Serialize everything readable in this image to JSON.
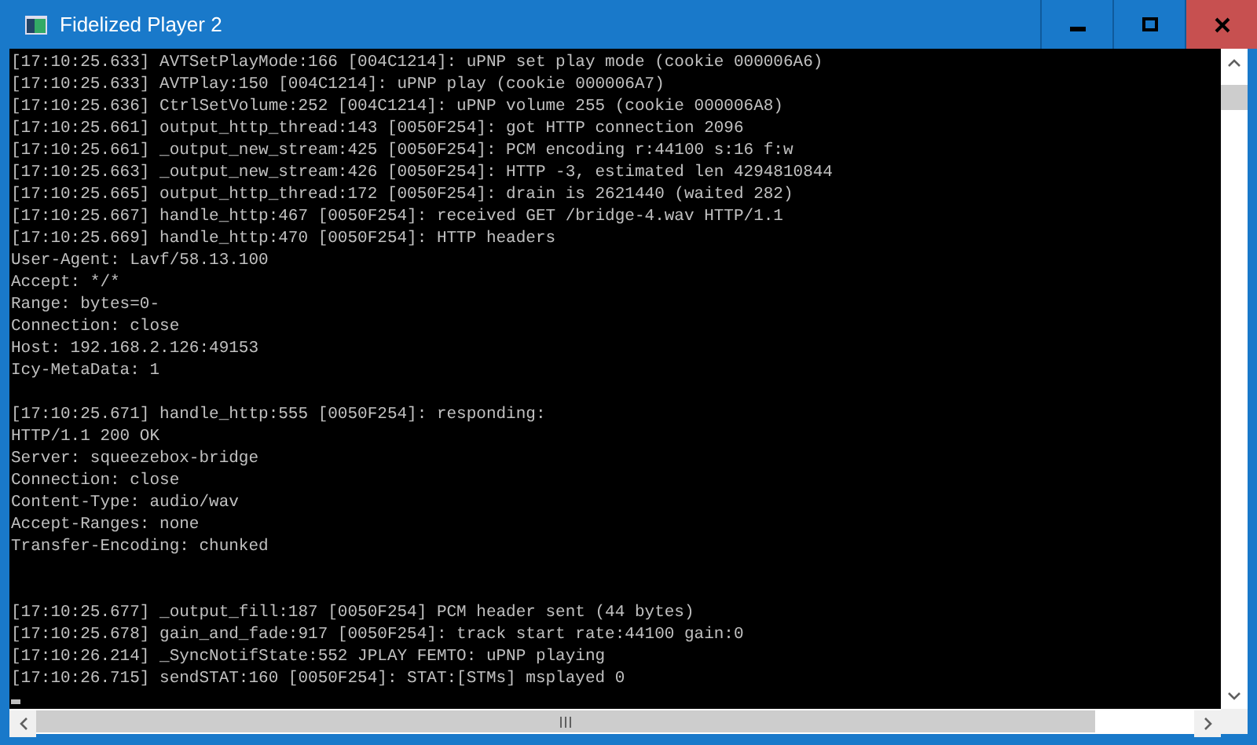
{
  "window": {
    "title": "Fidelized Player 2"
  },
  "console": {
    "lines": [
      {
        "text": "[17:10:25.633] AVTSetPlayMode:166 [004C1214]: uPNP set play mode (cookie 000006A6)"
      },
      {
        "text": "[17:10:25.633] AVTPlay:150 [004C1214]: uPNP play (cookie 000006A7)"
      },
      {
        "text": "[17:10:25.636] CtrlSetVolume:252 [004C1214]: uPNP volume 255 (cookie 000006A8)"
      },
      {
        "text": "[17:10:25.661] output_http_thread:143 [0050F254]: got HTTP connection 2096"
      },
      {
        "text": "[17:10:25.661] _output_new_stream:425 [0050F254]: PCM encoding r:44100 s:16 f:w"
      },
      {
        "text": "[17:10:25.663] _output_new_stream:426 [0050F254]: HTTP -3, estimated len 4294810844"
      },
      {
        "text": "[17:10:25.665] output_http_thread:172 [0050F254]: drain is 2621440 (waited 282)"
      },
      {
        "text": "[17:10:25.667] handle_http:467 [0050F254]: received GET /bridge-4.wav HTTP/1.1"
      },
      {
        "text": "[17:10:25.669] handle_http:470 [0050F254]: HTTP headers"
      },
      {
        "text": "User-Agent: Lavf/58.13.100"
      },
      {
        "text": "Accept: */*"
      },
      {
        "text": "Range: bytes=0-"
      },
      {
        "text": "Connection: close"
      },
      {
        "text": "Host: 192.168.2.126:49153"
      },
      {
        "text": "Icy-MetaData: 1"
      },
      {
        "kind": "blank"
      },
      {
        "text": "[17:10:25.671] handle_http:555 [0050F254]: responding:"
      },
      {
        "text": "HTTP/1.1 200 OK"
      },
      {
        "text": "Server: squeezebox-bridge"
      },
      {
        "text": "Connection: close"
      },
      {
        "text": "Content-Type: audio/wav"
      },
      {
        "text": "Accept-Ranges: none"
      },
      {
        "text": "Transfer-Encoding: chunked"
      },
      {
        "kind": "blank"
      },
      {
        "kind": "blank"
      },
      {
        "text": "[17:10:25.677] _output_fill:187 [0050F254] PCM header sent (44 bytes)"
      },
      {
        "text": "[17:10:25.678] gain_and_fade:917 [0050F254]: track start rate:44100 gain:0"
      },
      {
        "text": "[17:10:26.214] _SyncNotifState:552 JPLAY FEMTO: uPNP playing"
      },
      {
        "text": "[17:10:26.715] sendSTAT:160 [0050F254]: STAT:[STMs] msplayed 0"
      }
    ]
  }
}
